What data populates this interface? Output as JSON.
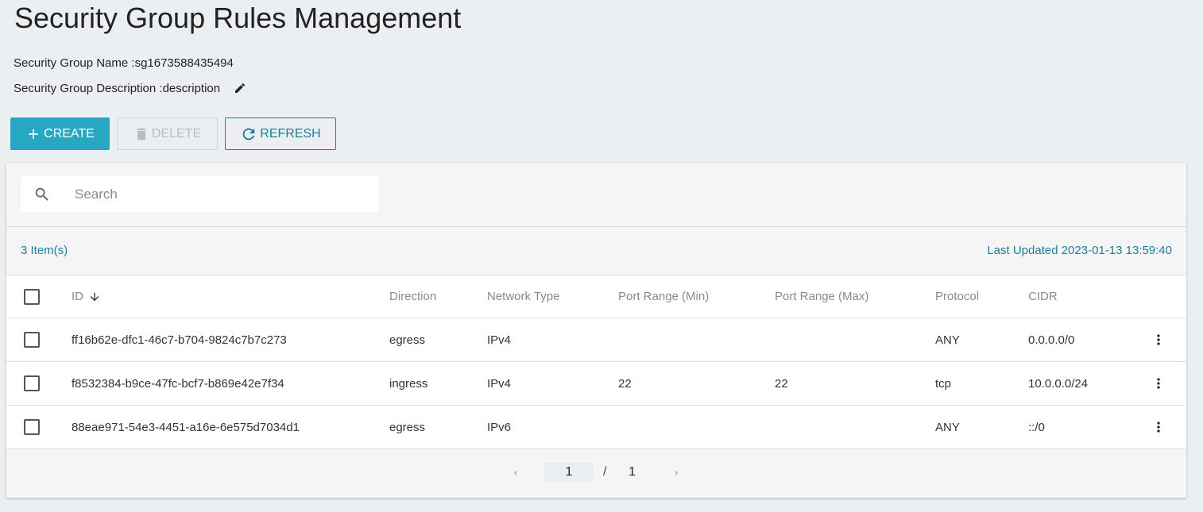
{
  "page": {
    "title": "Security Group Rules Management",
    "group_name_label": "Security Group Name : ",
    "group_name_value": "sg1673588435494",
    "group_desc_label": "Security Group Description : ",
    "group_desc_value": "description"
  },
  "toolbar": {
    "create_label": "CREATE",
    "delete_label": "DELETE",
    "refresh_label": "REFRESH"
  },
  "search": {
    "placeholder": "Search",
    "value": ""
  },
  "summary": {
    "items_count": "3 Item(s)",
    "last_updated": "Last Updated 2023-01-13 13:59:40"
  },
  "table": {
    "headers": {
      "id": "ID",
      "direction": "Direction",
      "network_type": "Network Type",
      "port_min": "Port Range (Min)",
      "port_max": "Port Range (Max)",
      "protocol": "Protocol",
      "cidr": "CIDR"
    },
    "rows": [
      {
        "id": "ff16b62e-dfc1-46c7-b704-9824c7b7c273",
        "direction": "egress",
        "network_type": "IPv4",
        "port_min": "",
        "port_max": "",
        "protocol": "ANY",
        "cidr": "0.0.0.0/0"
      },
      {
        "id": "f8532384-b9ce-47fc-bcf7-b869e42e7f34",
        "direction": "ingress",
        "network_type": "IPv4",
        "port_min": "22",
        "port_max": "22",
        "protocol": "tcp",
        "cidr": "10.0.0.0/24"
      },
      {
        "id": "88eae971-54e3-4451-a16e-6e575d7034d1",
        "direction": "egress",
        "network_type": "IPv6",
        "port_min": "",
        "port_max": "",
        "protocol": "ANY",
        "cidr": "::/0"
      }
    ]
  },
  "pagination": {
    "current": "1",
    "separator": "/",
    "total": "1"
  },
  "colors": {
    "accent": "#27a8c2",
    "link": "#1d7f98",
    "background": "#eceff2"
  },
  "icons": {
    "edit": "pencil-icon",
    "create": "plus-icon",
    "delete": "trash-icon",
    "refresh": "refresh-icon",
    "search": "search-icon",
    "sort": "arrow-down-icon",
    "row_menu": "more-vert-icon",
    "prev": "chevron-left-icon",
    "next": "chevron-right-icon"
  }
}
